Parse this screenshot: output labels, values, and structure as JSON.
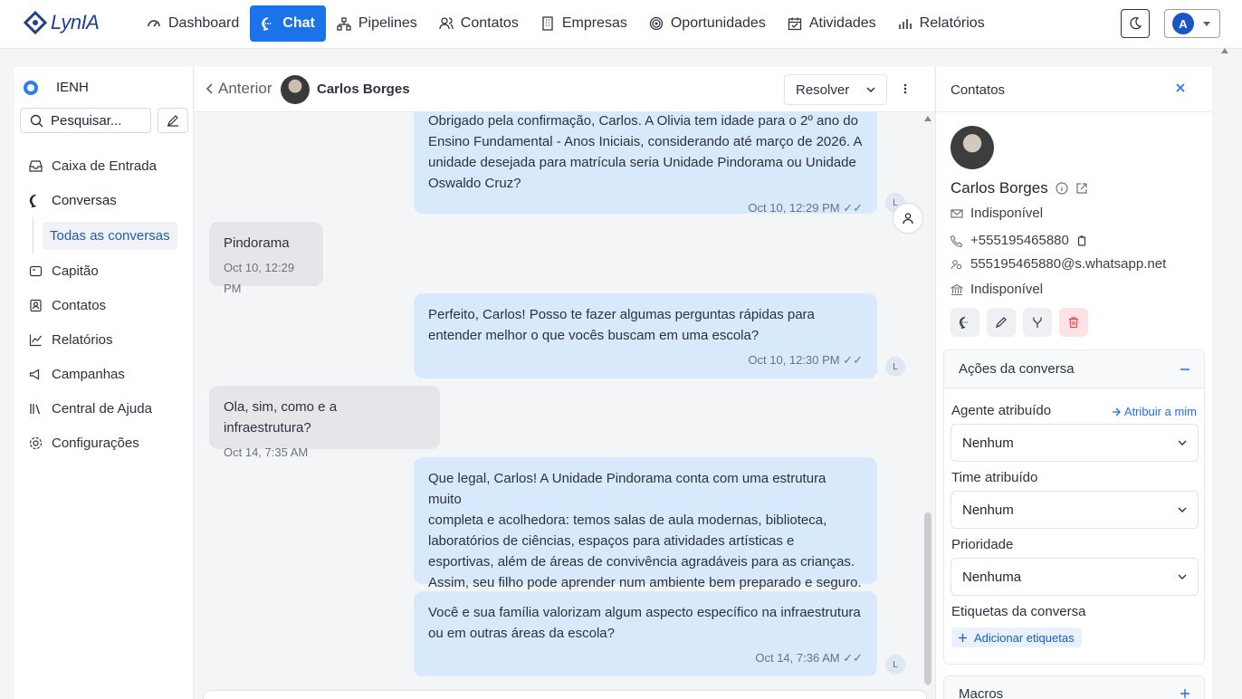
{
  "app": {
    "logo_text": "LynIA"
  },
  "nav": {
    "items": [
      {
        "label": "Dashboard",
        "icon": "dashboard-icon"
      },
      {
        "label": "Chat",
        "icon": "chat-icon",
        "active": true
      },
      {
        "label": "Pipelines",
        "icon": "pipelines-icon"
      },
      {
        "label": "Contatos",
        "icon": "contacts-icon"
      },
      {
        "label": "Empresas",
        "icon": "building-icon"
      },
      {
        "label": "Oportunidades",
        "icon": "target-icon"
      },
      {
        "label": "Atividades",
        "icon": "calendar-icon"
      },
      {
        "label": "Relatórios",
        "icon": "bar-chart-icon"
      }
    ],
    "theme_icon": "moon-icon",
    "user_initial": "A",
    "accent": "#1a73e8"
  },
  "sidebar": {
    "org_name": "IENH",
    "search_placeholder": "Pesquisar...",
    "items": [
      {
        "label": "Caixa de Entrada",
        "icon": "inbox-icon"
      },
      {
        "label": "Conversas",
        "icon": "conversation-icon"
      },
      {
        "label": "Todas as conversas",
        "sub": true
      },
      {
        "label": "Capitão",
        "icon": "captain-icon"
      },
      {
        "label": "Contatos",
        "icon": "contact-card-icon"
      },
      {
        "label": "Relatórios",
        "icon": "line-chart-icon"
      },
      {
        "label": "Campanhas",
        "icon": "megaphone-icon"
      },
      {
        "label": "Central de Ajuda",
        "icon": "library-icon"
      },
      {
        "label": "Configurações",
        "icon": "settings-icon"
      }
    ]
  },
  "chat": {
    "back_label": "Anterior",
    "contact_name": "Carlos Borges",
    "resolve_label": "Resolver",
    "messages": [
      {
        "dir": "out",
        "lines": [
          "Obrigado pela confirmação, Carlos. A Olivia tem idade para o 2º ano do",
          "Ensino Fundamental - Anos Iniciais, considerando até março de 2026. A",
          "unidade desejada para matrícula seria Unidade Pindorama ou Unidade",
          "Oswaldo Cruz?"
        ],
        "time": "Oct 10, 12:29 PM",
        "badge": "L"
      },
      {
        "dir": "in",
        "lines": [
          "Pindorama"
        ],
        "time": "Oct 10, 12:29 PM"
      },
      {
        "dir": "out",
        "lines": [
          "Perfeito, Carlos! Posso te fazer algumas perguntas rápidas para",
          "entender melhor o que vocês buscam em uma escola?"
        ],
        "time": "Oct 10, 12:30 PM",
        "badge": "L"
      },
      {
        "dir": "in",
        "lines": [
          "Ola, sim, como e a infraestrutura?"
        ],
        "time": "Oct 14, 7:35 AM"
      },
      {
        "dir": "out",
        "lines": [
          "Que legal, Carlos! A Unidade Pindorama conta com uma estrutura muito",
          "completa e acolhedora: temos salas de aula modernas, biblioteca,",
          "laboratórios de ciências, espaços para atividades artísticas e",
          "esportivas, além de áreas de convivência agradáveis para as crianças.",
          "Assim, seu filho pode aprender num ambiente bem preparado e seguro."
        ]
      },
      {
        "dir": "out",
        "lines": [
          "Você e sua família valorizam algum aspecto específico na infraestrutura",
          "ou em outras áreas da escola?"
        ],
        "time": "Oct 14, 7:36 AM",
        "badge": "L"
      }
    ]
  },
  "contact_panel": {
    "title": "Contatos",
    "name": "Carlos Borges",
    "email": "Indisponível",
    "phone": "+555195465880",
    "whatsapp": "555195465880@s.whatsapp.net",
    "company": "Indisponível",
    "actions_title": "Ações da conversa",
    "agent_label": "Agente atribuído",
    "assign_me": "Atribuir a mim",
    "agent_value": "Nenhum",
    "team_label": "Time atribuído",
    "team_value": "Nenhum",
    "priority_label": "Prioridade",
    "priority_value": "Nenhuma",
    "tags_label": "Etiquetas da conversa",
    "add_tags": "Adicionar etiquetas",
    "macros_title": "Macros"
  }
}
